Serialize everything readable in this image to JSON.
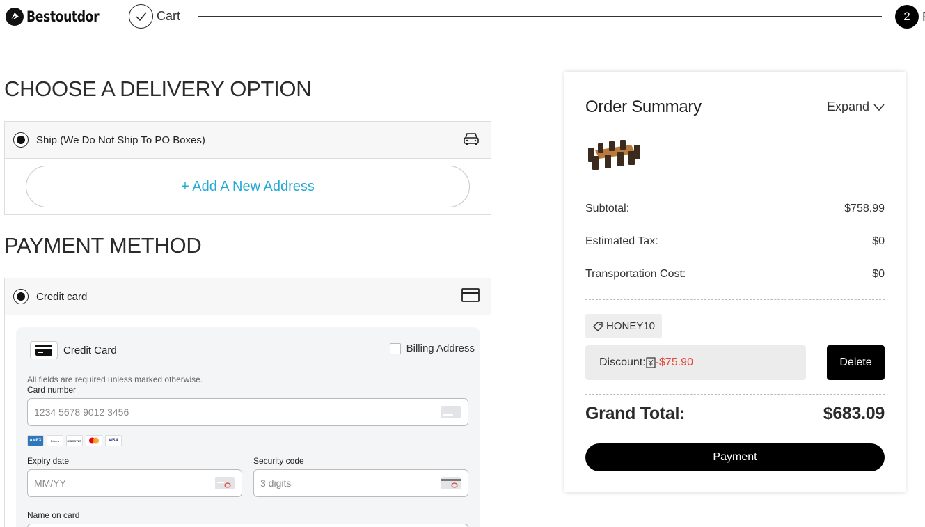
{
  "header": {
    "brand": "Bestoutdor",
    "steps": [
      {
        "label": "Cart",
        "state": "done"
      },
      {
        "number": "2",
        "label": "P",
        "state": "active"
      }
    ]
  },
  "delivery": {
    "title": "CHOOSE A DELIVERY OPTION",
    "option_label": "Ship (We Do Not Ship To PO Boxes)",
    "add_address": "+ Add A New Address",
    "option_icon": "car-icon"
  },
  "payment": {
    "title": "PAYMENT METHOD",
    "option_label": "Credit card",
    "option_icon": "card-icon",
    "form": {
      "title": "Credit Card",
      "billing_label": "Billing Address",
      "required_note": "All fields are required unless marked otherwise.",
      "card_number_label": "Card number",
      "card_number_placeholder": "1234 5678 9012 3456",
      "brands": [
        "AMEX",
        "Diners",
        "DISCOVER",
        "Mastercard",
        "VISA"
      ],
      "expiry_label": "Expiry date",
      "expiry_placeholder": "MM/YY",
      "security_label": "Security code",
      "security_placeholder": "3 digits",
      "name_label": "Name on card"
    }
  },
  "summary": {
    "title": "Order Summary",
    "expand_label": "Expand",
    "rows": [
      {
        "label": "Subtotal:",
        "value": "$758.99"
      },
      {
        "label": "Estimated Tax:",
        "value": "$0"
      },
      {
        "label": "Transportation Cost:",
        "value": "$0"
      }
    ],
    "coupon_code": "HONEY10",
    "discount_label": "Discount:",
    "discount_value": "-$75.90",
    "delete_label": "Delete",
    "grand_total_label": "Grand Total:",
    "grand_total_value": "$683.09",
    "pay_label": "Payment"
  },
  "colors": {
    "accent_link": "#25a9d6",
    "discount_red": "#e4493a",
    "primary_button": "#000000"
  }
}
